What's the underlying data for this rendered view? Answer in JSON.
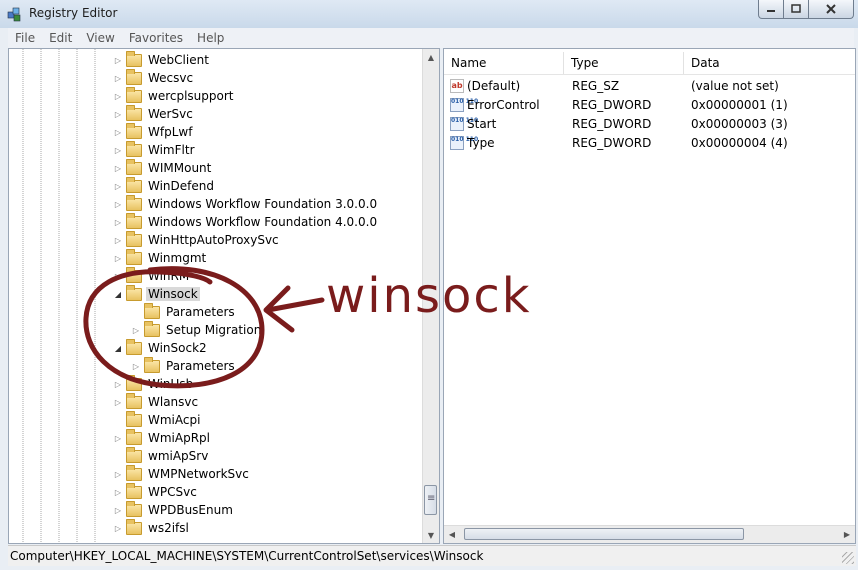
{
  "window": {
    "title": "Registry Editor",
    "controls": {
      "minimize_icon": "minimize-icon",
      "maximize_icon": "maximize-icon",
      "close_icon": "close-icon"
    }
  },
  "menu": [
    "File",
    "Edit",
    "View",
    "Favorites",
    "Help"
  ],
  "tree": {
    "items": [
      {
        "label": "WebClient",
        "level": 0,
        "expander": "collapsed"
      },
      {
        "label": "Wecsvc",
        "level": 0,
        "expander": "collapsed"
      },
      {
        "label": "wercplsupport",
        "level": 0,
        "expander": "collapsed"
      },
      {
        "label": "WerSvc",
        "level": 0,
        "expander": "collapsed"
      },
      {
        "label": "WfpLwf",
        "level": 0,
        "expander": "collapsed"
      },
      {
        "label": "WimFltr",
        "level": 0,
        "expander": "collapsed"
      },
      {
        "label": "WIMMount",
        "level": 0,
        "expander": "collapsed"
      },
      {
        "label": "WinDefend",
        "level": 0,
        "expander": "collapsed"
      },
      {
        "label": "Windows Workflow Foundation 3.0.0.0",
        "level": 0,
        "expander": "collapsed"
      },
      {
        "label": "Windows Workflow Foundation 4.0.0.0",
        "level": 0,
        "expander": "collapsed"
      },
      {
        "label": "WinHttpAutoProxySvc",
        "level": 0,
        "expander": "collapsed"
      },
      {
        "label": "Winmgmt",
        "level": 0,
        "expander": "collapsed"
      },
      {
        "label": "WinRM",
        "level": 0,
        "expander": "collapsed"
      },
      {
        "label": "Winsock",
        "level": 0,
        "expander": "expanded",
        "selected": true
      },
      {
        "label": "Parameters",
        "level": 1,
        "expander": "none"
      },
      {
        "label": "Setup Migration",
        "level": 1,
        "expander": "collapsed"
      },
      {
        "label": "WinSock2",
        "level": 0,
        "expander": "expanded"
      },
      {
        "label": "Parameters",
        "level": 1,
        "expander": "collapsed"
      },
      {
        "label": "WinUsb",
        "level": 0,
        "expander": "collapsed"
      },
      {
        "label": "Wlansvc",
        "level": 0,
        "expander": "collapsed"
      },
      {
        "label": "WmiAcpi",
        "level": 0,
        "expander": "none"
      },
      {
        "label": "WmiApRpl",
        "level": 0,
        "expander": "collapsed"
      },
      {
        "label": "wmiApSrv",
        "level": 0,
        "expander": "none"
      },
      {
        "label": "WMPNetworkSvc",
        "level": 0,
        "expander": "collapsed"
      },
      {
        "label": "WPCSvc",
        "level": 0,
        "expander": "collapsed"
      },
      {
        "label": "WPDBusEnum",
        "level": 0,
        "expander": "collapsed"
      },
      {
        "label": "ws2ifsl",
        "level": 0,
        "expander": "collapsed"
      }
    ]
  },
  "values": {
    "columns": [
      "Name",
      "Type",
      "Data"
    ],
    "rows": [
      {
        "name": "(Default)",
        "type": "REG_SZ",
        "data": "(value not set)",
        "icon": "string-value-icon"
      },
      {
        "name": "ErrorControl",
        "type": "REG_DWORD",
        "data": "0x00000001 (1)",
        "icon": "dword-value-icon"
      },
      {
        "name": "Start",
        "type": "REG_DWORD",
        "data": "0x00000003 (3)",
        "icon": "dword-value-icon"
      },
      {
        "name": "Type",
        "type": "REG_DWORD",
        "data": "0x00000004 (4)",
        "icon": "dword-value-icon"
      }
    ]
  },
  "status": {
    "path": "Computer\\HKEY_LOCAL_MACHINE\\SYSTEM\\CurrentControlSet\\services\\Winsock"
  },
  "annotation": {
    "text": "winsock",
    "color": "#7a1c1c"
  }
}
